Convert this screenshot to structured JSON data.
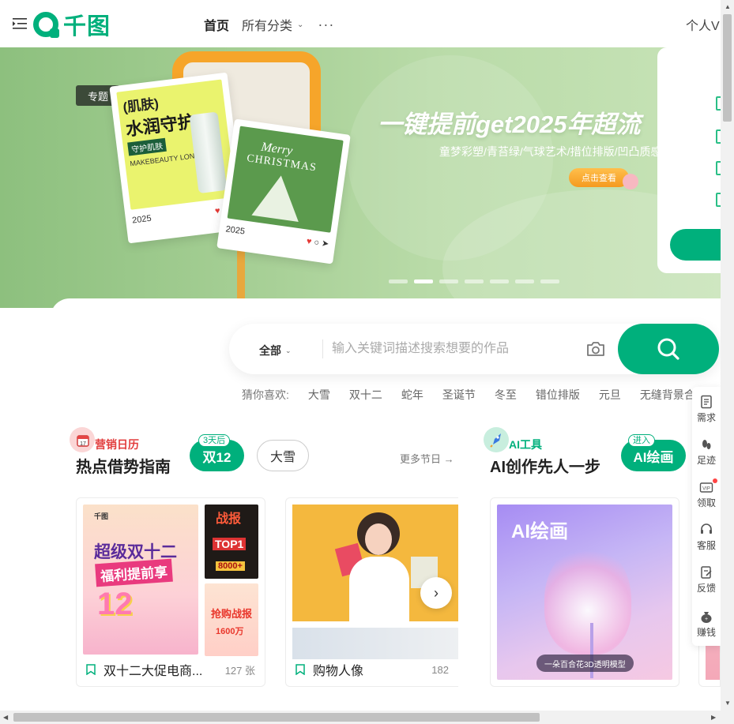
{
  "header": {
    "logo_text": "千图",
    "nav_home": "首页",
    "nav_categories": "所有分类",
    "nav_more": "···",
    "user_vip": "个人V"
  },
  "banner": {
    "topic_tag": "专题",
    "card1_title1": "(肌肤)",
    "card1_title2": "水润守护",
    "card1_badge": "守护肌肤",
    "card1_sub": "MAKEBEAUTY LONGER",
    "card1_year": "2025",
    "card2_title1": "Merry",
    "card2_title2": "CHRISTMAS",
    "card2_year": "2025",
    "headline": "一键提前get2025年超流",
    "subline": "童梦彩塑/青苔绿/气球艺术/措位排版/凹凸质感",
    "cta": "点击查看",
    "dots_total": 7,
    "dots_active": 2
  },
  "search": {
    "category": "全部",
    "placeholder": "输入关键词描述搜索想要的作品",
    "value": ""
  },
  "guess": {
    "label": "猜你喜欢:",
    "keywords": [
      "大雪",
      "双十二",
      "蛇年",
      "圣诞节",
      "冬至",
      "错位排版",
      "元旦",
      "无缝背景合"
    ]
  },
  "marketing": {
    "tag": "营销日历",
    "title": "热点借势指南",
    "pill_active": "双12",
    "pill_badge": "3天后",
    "pill_other": "大雪",
    "more": "更多节日 →",
    "tile1": {
      "poster_brand": "千图",
      "poster_t1": "超级双十二",
      "poster_t2": "福利提前享",
      "poster_big": "12",
      "side1_title": "战报",
      "side1_badge": "TOP1",
      "side1_num": "8000+",
      "side2_title": "抢购战报",
      "side2_num": "1600万",
      "label": "双十二大促电商...",
      "count": "127 张"
    },
    "tile2": {
      "label": "购物人像",
      "count": "182"
    }
  },
  "ai": {
    "tag": "AI工具",
    "title": "AI创作先人一步",
    "pill": "AI绘画",
    "pill_badge": "进入",
    "image_title": "AI绘画",
    "caption": "一朵百合花3D透明模型"
  },
  "float_bar": {
    "items": [
      "需求",
      "足迹",
      "领取",
      "客服",
      "反馈",
      "赚钱"
    ]
  },
  "colors": {
    "brand": "#00b07c",
    "marketing_tag": "#e23d3d",
    "ai_tag": "#00b07c"
  }
}
